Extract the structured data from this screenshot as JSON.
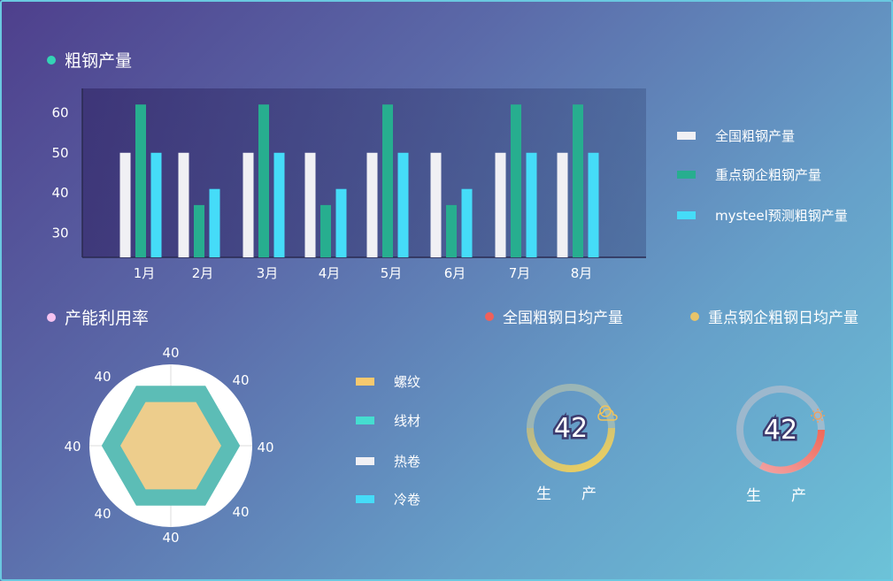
{
  "colors": {
    "white": "#f0f0f4",
    "green": "#27ae8f",
    "cyan": "#45dcf8",
    "yellow": "#f6c96e",
    "teal": "#45ddd0",
    "red_dot": "#f0605a",
    "gold_dot": "#e8c46a",
    "pink_dot": "#f6c3f0",
    "title_dot": "#34d3b5"
  },
  "bar_section": {
    "title": "粗钢产量"
  },
  "chart_data": [
    {
      "type": "bar",
      "categories": [
        "1月",
        "2月",
        "3月",
        "4月",
        "5月",
        "6月",
        "7月",
        "8月"
      ],
      "series": [
        {
          "name": "全国粗钢产量",
          "values": [
            50,
            50,
            50,
            50,
            50,
            50,
            50,
            50
          ]
        },
        {
          "name": "重点钢企粗钢产量",
          "values": [
            62,
            37,
            62,
            37,
            62,
            37,
            62,
            62
          ]
        },
        {
          "name": "mysteel预测粗钢产量",
          "values": [
            50,
            41,
            50,
            41,
            50,
            41,
            50,
            50
          ]
        }
      ],
      "yticks": [
        "30",
        "40",
        "50",
        "60"
      ],
      "ylim": [
        24,
        66
      ],
      "legend": "right"
    },
    {
      "type": "radar",
      "axes_labels": [
        "40",
        "40",
        "40",
        "40",
        "40",
        "40",
        "40",
        "40"
      ],
      "series": [
        {
          "name": "螺纹",
          "values": [
            0.62,
            0.62,
            0.62,
            0.62,
            0.62,
            0.62
          ]
        },
        {
          "name": "线材",
          "values": [
            0.85,
            0.85,
            0.85,
            0.85,
            0.85,
            0.85
          ]
        },
        {
          "name": "热卷",
          "values": []
        },
        {
          "name": "冷卷",
          "values": []
        }
      ],
      "legend": "right"
    }
  ],
  "radar_section": {
    "title": "产能利用率"
  },
  "gauges": [
    {
      "title": "全国粗钢日均产量",
      "value": "42",
      "label": "生产",
      "icon": "partly-cloudy-icon"
    },
    {
      "title": "重点钢企粗钢日均产量",
      "value": "42",
      "label": "生产",
      "icon": "sun-icon"
    }
  ]
}
